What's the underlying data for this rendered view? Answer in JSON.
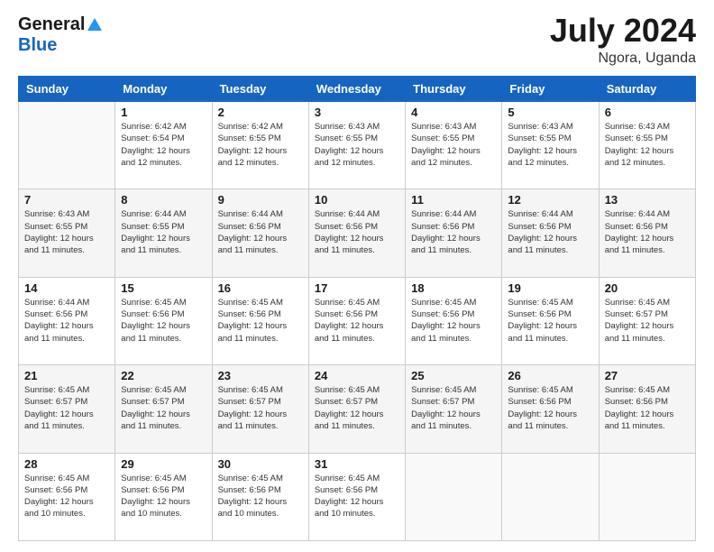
{
  "header": {
    "logo_general": "General",
    "logo_blue": "Blue",
    "title": "July 2024",
    "location": "Ngora, Uganda"
  },
  "weekdays": [
    "Sunday",
    "Monday",
    "Tuesday",
    "Wednesday",
    "Thursday",
    "Friday",
    "Saturday"
  ],
  "weeks": [
    [
      {
        "day": "",
        "sunrise": "",
        "sunset": "",
        "daylight": ""
      },
      {
        "day": "1",
        "sunrise": "Sunrise: 6:42 AM",
        "sunset": "Sunset: 6:54 PM",
        "daylight": "Daylight: 12 hours and 12 minutes."
      },
      {
        "day": "2",
        "sunrise": "Sunrise: 6:42 AM",
        "sunset": "Sunset: 6:55 PM",
        "daylight": "Daylight: 12 hours and 12 minutes."
      },
      {
        "day": "3",
        "sunrise": "Sunrise: 6:43 AM",
        "sunset": "Sunset: 6:55 PM",
        "daylight": "Daylight: 12 hours and 12 minutes."
      },
      {
        "day": "4",
        "sunrise": "Sunrise: 6:43 AM",
        "sunset": "Sunset: 6:55 PM",
        "daylight": "Daylight: 12 hours and 12 minutes."
      },
      {
        "day": "5",
        "sunrise": "Sunrise: 6:43 AM",
        "sunset": "Sunset: 6:55 PM",
        "daylight": "Daylight: 12 hours and 12 minutes."
      },
      {
        "day": "6",
        "sunrise": "Sunrise: 6:43 AM",
        "sunset": "Sunset: 6:55 PM",
        "daylight": "Daylight: 12 hours and 12 minutes."
      }
    ],
    [
      {
        "day": "7",
        "sunrise": "Sunrise: 6:43 AM",
        "sunset": "Sunset: 6:55 PM",
        "daylight": "Daylight: 12 hours and 11 minutes."
      },
      {
        "day": "8",
        "sunrise": "Sunrise: 6:44 AM",
        "sunset": "Sunset: 6:55 PM",
        "daylight": "Daylight: 12 hours and 11 minutes."
      },
      {
        "day": "9",
        "sunrise": "Sunrise: 6:44 AM",
        "sunset": "Sunset: 6:56 PM",
        "daylight": "Daylight: 12 hours and 11 minutes."
      },
      {
        "day": "10",
        "sunrise": "Sunrise: 6:44 AM",
        "sunset": "Sunset: 6:56 PM",
        "daylight": "Daylight: 12 hours and 11 minutes."
      },
      {
        "day": "11",
        "sunrise": "Sunrise: 6:44 AM",
        "sunset": "Sunset: 6:56 PM",
        "daylight": "Daylight: 12 hours and 11 minutes."
      },
      {
        "day": "12",
        "sunrise": "Sunrise: 6:44 AM",
        "sunset": "Sunset: 6:56 PM",
        "daylight": "Daylight: 12 hours and 11 minutes."
      },
      {
        "day": "13",
        "sunrise": "Sunrise: 6:44 AM",
        "sunset": "Sunset: 6:56 PM",
        "daylight": "Daylight: 12 hours and 11 minutes."
      }
    ],
    [
      {
        "day": "14",
        "sunrise": "Sunrise: 6:44 AM",
        "sunset": "Sunset: 6:56 PM",
        "daylight": "Daylight: 12 hours and 11 minutes."
      },
      {
        "day": "15",
        "sunrise": "Sunrise: 6:45 AM",
        "sunset": "Sunset: 6:56 PM",
        "daylight": "Daylight: 12 hours and 11 minutes."
      },
      {
        "day": "16",
        "sunrise": "Sunrise: 6:45 AM",
        "sunset": "Sunset: 6:56 PM",
        "daylight": "Daylight: 12 hours and 11 minutes."
      },
      {
        "day": "17",
        "sunrise": "Sunrise: 6:45 AM",
        "sunset": "Sunset: 6:56 PM",
        "daylight": "Daylight: 12 hours and 11 minutes."
      },
      {
        "day": "18",
        "sunrise": "Sunrise: 6:45 AM",
        "sunset": "Sunset: 6:56 PM",
        "daylight": "Daylight: 12 hours and 11 minutes."
      },
      {
        "day": "19",
        "sunrise": "Sunrise: 6:45 AM",
        "sunset": "Sunset: 6:56 PM",
        "daylight": "Daylight: 12 hours and 11 minutes."
      },
      {
        "day": "20",
        "sunrise": "Sunrise: 6:45 AM",
        "sunset": "Sunset: 6:57 PM",
        "daylight": "Daylight: 12 hours and 11 minutes."
      }
    ],
    [
      {
        "day": "21",
        "sunrise": "Sunrise: 6:45 AM",
        "sunset": "Sunset: 6:57 PM",
        "daylight": "Daylight: 12 hours and 11 minutes."
      },
      {
        "day": "22",
        "sunrise": "Sunrise: 6:45 AM",
        "sunset": "Sunset: 6:57 PM",
        "daylight": "Daylight: 12 hours and 11 minutes."
      },
      {
        "day": "23",
        "sunrise": "Sunrise: 6:45 AM",
        "sunset": "Sunset: 6:57 PM",
        "daylight": "Daylight: 12 hours and 11 minutes."
      },
      {
        "day": "24",
        "sunrise": "Sunrise: 6:45 AM",
        "sunset": "Sunset: 6:57 PM",
        "daylight": "Daylight: 12 hours and 11 minutes."
      },
      {
        "day": "25",
        "sunrise": "Sunrise: 6:45 AM",
        "sunset": "Sunset: 6:57 PM",
        "daylight": "Daylight: 12 hours and 11 minutes."
      },
      {
        "day": "26",
        "sunrise": "Sunrise: 6:45 AM",
        "sunset": "Sunset: 6:56 PM",
        "daylight": "Daylight: 12 hours and 11 minutes."
      },
      {
        "day": "27",
        "sunrise": "Sunrise: 6:45 AM",
        "sunset": "Sunset: 6:56 PM",
        "daylight": "Daylight: 12 hours and 11 minutes."
      }
    ],
    [
      {
        "day": "28",
        "sunrise": "Sunrise: 6:45 AM",
        "sunset": "Sunset: 6:56 PM",
        "daylight": "Daylight: 12 hours and 10 minutes."
      },
      {
        "day": "29",
        "sunrise": "Sunrise: 6:45 AM",
        "sunset": "Sunset: 6:56 PM",
        "daylight": "Daylight: 12 hours and 10 minutes."
      },
      {
        "day": "30",
        "sunrise": "Sunrise: 6:45 AM",
        "sunset": "Sunset: 6:56 PM",
        "daylight": "Daylight: 12 hours and 10 minutes."
      },
      {
        "day": "31",
        "sunrise": "Sunrise: 6:45 AM",
        "sunset": "Sunset: 6:56 PM",
        "daylight": "Daylight: 12 hours and 10 minutes."
      },
      {
        "day": "",
        "sunrise": "",
        "sunset": "",
        "daylight": ""
      },
      {
        "day": "",
        "sunrise": "",
        "sunset": "",
        "daylight": ""
      },
      {
        "day": "",
        "sunrise": "",
        "sunset": "",
        "daylight": ""
      }
    ]
  ]
}
